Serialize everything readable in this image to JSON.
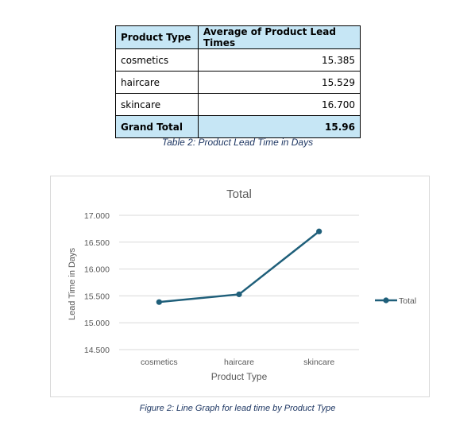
{
  "table": {
    "headers": [
      "Product Type",
      "Average of Product Lead Times"
    ],
    "rows": [
      [
        "cosmetics",
        "15.385"
      ],
      [
        "haircare",
        "15.529"
      ],
      [
        "skincare",
        "16.700"
      ]
    ],
    "total": [
      "Grand Total",
      "15.96"
    ],
    "caption": "Table 2: Product Lead Time in Days"
  },
  "chart_data": {
    "type": "line",
    "title": "Total",
    "xlabel": "Product Type",
    "ylabel": "Lead Time in Days",
    "categories": [
      "cosmetics",
      "haircare",
      "skincare"
    ],
    "series": [
      {
        "name": "Total",
        "values": [
          15.385,
          15.529,
          16.7
        ]
      }
    ],
    "ylim": [
      14.5,
      17.0
    ],
    "yticks": [
      "14.500",
      "15.000",
      "15.500",
      "16.000",
      "16.500",
      "17.000"
    ],
    "grid": true,
    "legend_position": "right",
    "colors": {
      "line": "#1f5f7a",
      "grid": "#d9d9d9",
      "text": "#595959"
    }
  },
  "figure_caption": "Figure 2: Line Graph for lead time by Product Type"
}
